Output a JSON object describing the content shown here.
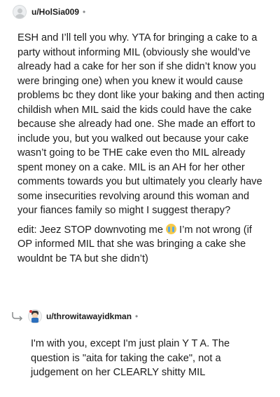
{
  "comment": {
    "username": "u/HolSia009",
    "separator": "•",
    "paragraph1": "ESH and I’ll tell you why. YTA for bringing a cake to a party without informing MIL (obviously she would’ve already had a cake for her son if she didn’t know you were bringing one) when you knew it would cause problems bc they dont like your baking and then acting childish when MIL said the kids could have the cake because she already had one. She made an effort to include you, but you walked out because your cake wasn’t going to be THE cake even tho MIL already spent money on a cake. MIL is an AH for her other comments towards you but ultimately you clearly have some insecurities revolving around this woman and your fiances family so might I suggest therapy?",
    "paragraph2_before": "edit: Jeez STOP downvoting me ",
    "paragraph2_emoji": "crying-face",
    "paragraph2_after": " I’m not wrong (if OP informed MIL that she was bringing a cake she wouldnt be TA but she didn’t)"
  },
  "reply": {
    "username": "u/throwitawayidkman",
    "separator": "•",
    "text": "I'm with you, except I'm just plain Y T A. The question is \"aita for taking the cake\", not a judgement on her CLEARLY shitty MIL"
  },
  "icons": {
    "avatar": "default-avatar-icon",
    "reply_arrow": "reply-arrow-icon",
    "reply_avatar": "custom-avatar-icon"
  },
  "colors": {
    "text": "#1c1c1c",
    "meta": "#878a8c",
    "thread_line": "#d7dadc"
  }
}
